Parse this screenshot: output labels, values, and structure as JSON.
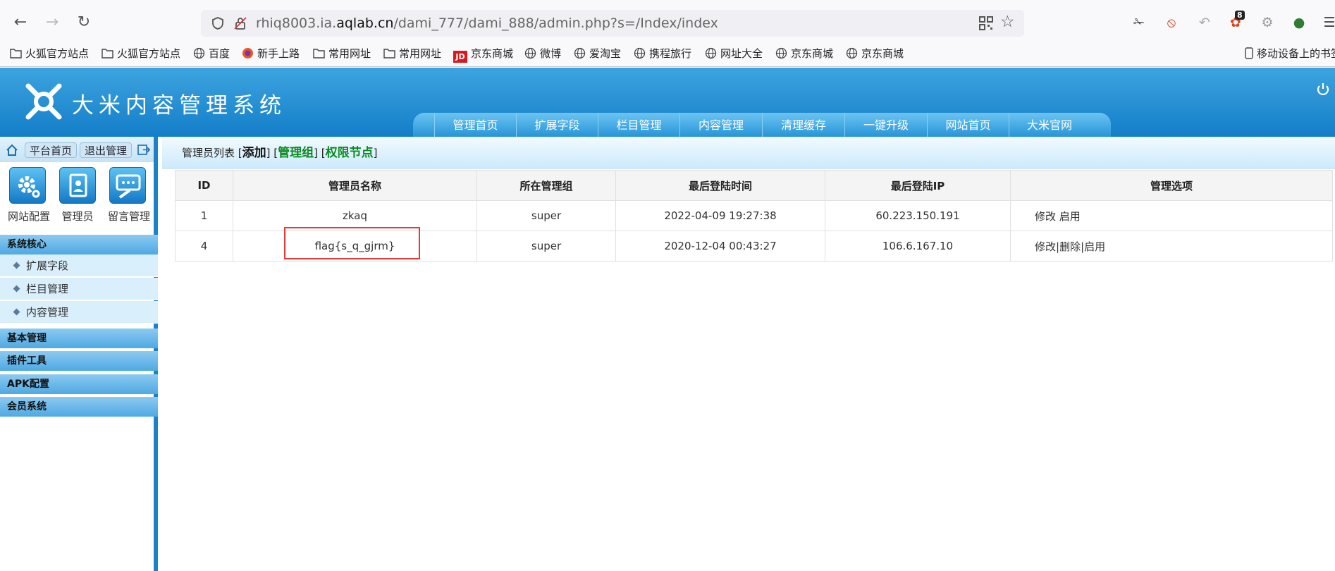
{
  "browser": {
    "url_prefix": "rhiq8003.ia.",
    "url_domain": "aqlab.cn",
    "url_path": "/dami_777/dami_888/admin.php?s=/Index/index",
    "ext_badge": "8",
    "bookmarks": [
      "火狐官方站点",
      "火狐官方站点",
      "百度",
      "新手上路",
      "常用网址",
      "常用网址",
      "京东商城",
      "微博",
      "爱淘宝",
      "携程旅行",
      "网址大全",
      "京东商城",
      "京东商城"
    ],
    "mobile_bookmarks": "移动设备上的书签"
  },
  "header": {
    "title": "大米内容管理系统",
    "nav": [
      "管理首页",
      "扩展字段",
      "栏目管理",
      "内容管理",
      "清理缓存",
      "一键升级",
      "网站首页",
      "大米官网"
    ]
  },
  "sidebar": {
    "top_buttons": [
      "平台首页",
      "退出管理"
    ],
    "quick_links": [
      "网站配置",
      "管理员",
      "留言管理"
    ],
    "sections": [
      {
        "title": "系统核心",
        "items": [
          "扩展字段",
          "栏目管理",
          "内容管理"
        ]
      },
      {
        "title": "基本管理",
        "items": []
      },
      {
        "title": "插件工具",
        "items": []
      },
      {
        "title": "APK配置",
        "items": []
      },
      {
        "title": "会员系统",
        "items": []
      }
    ]
  },
  "main": {
    "breadcrumb_label": "管理员列表",
    "breadcrumb_links": [
      "添加",
      "管理组",
      "权限节点"
    ],
    "table": {
      "headers": [
        "ID",
        "管理员名称",
        "所在管理组",
        "最后登陆时间",
        "最后登陆IP",
        "管理选项"
      ],
      "rows": [
        {
          "id": "1",
          "name": "zkaq",
          "group": "super",
          "time": "2022-04-09 19:27:38",
          "ip": "60.223.150.191",
          "actions": [
            "修改",
            "启用"
          ],
          "sep": " "
        },
        {
          "id": "4",
          "name": "flag{s_q_gjrm}",
          "group": "super",
          "time": "2020-12-04 00:43:27",
          "ip": "106.6.167.10",
          "actions": [
            "修改",
            "删除",
            "启用"
          ],
          "sep": "|"
        }
      ]
    }
  },
  "colors": {
    "header_blue": "#137ec8",
    "link_green": "#0a8a22",
    "highlight_red": "#e53935"
  }
}
